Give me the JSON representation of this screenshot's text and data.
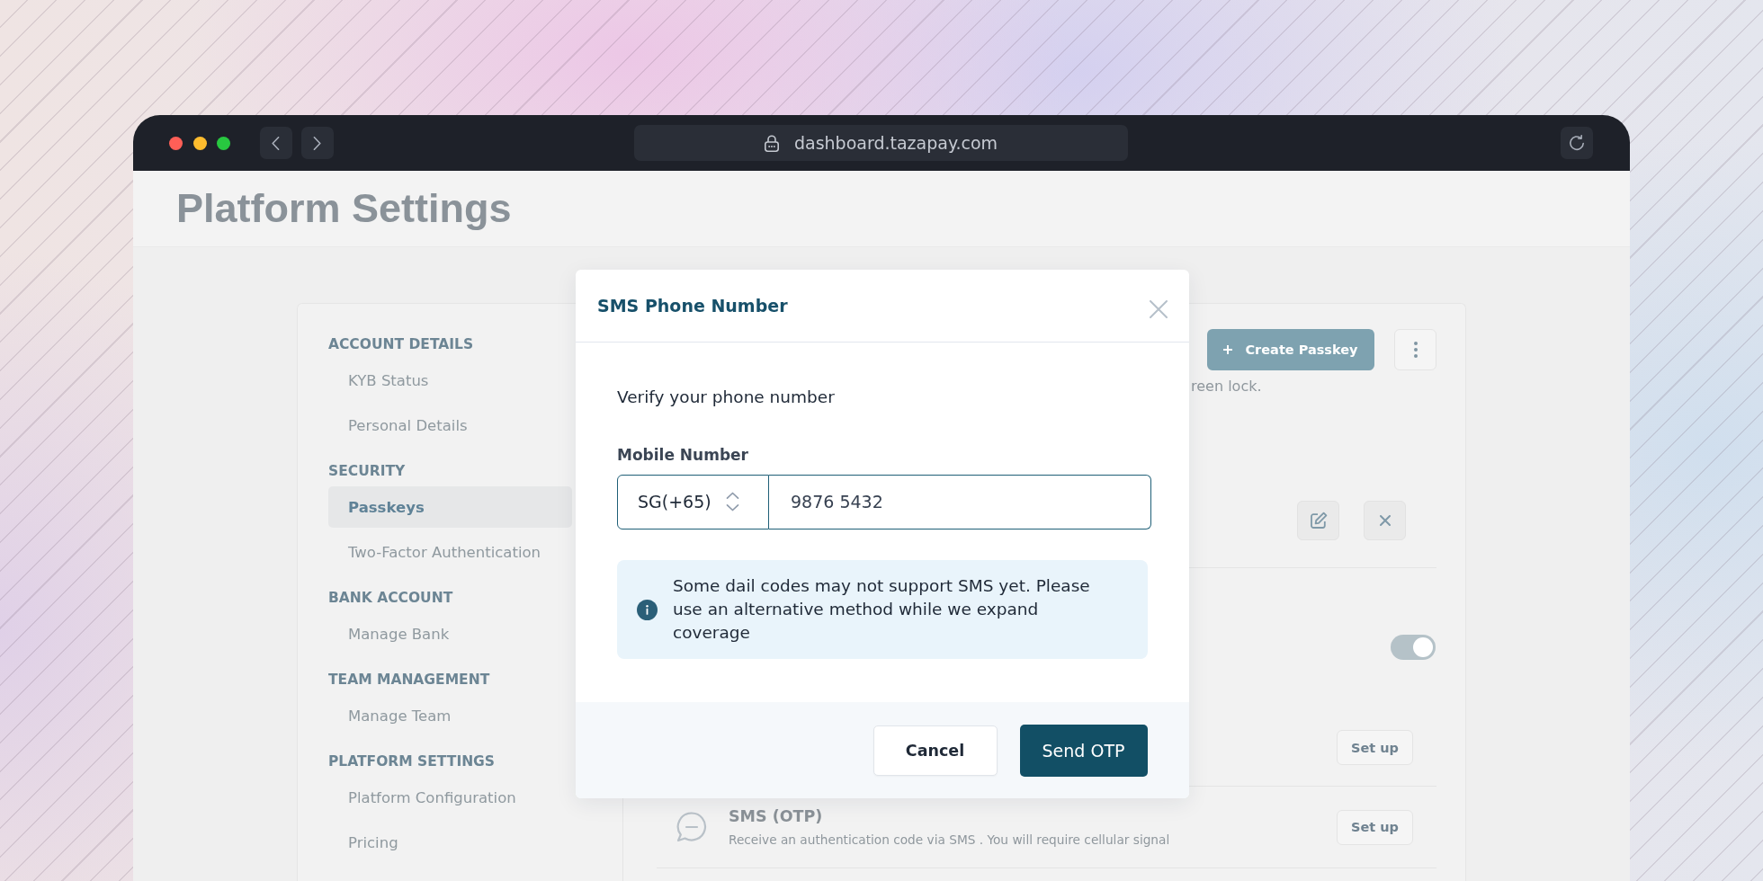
{
  "browser": {
    "url": "dashboard.tazapay.com"
  },
  "page": {
    "title": "Platform Settings",
    "sidebar": [
      {
        "heading": "ACCOUNT DETAILS",
        "items": [
          {
            "label": "KYB Status",
            "selected": false
          },
          {
            "label": "Personal Details",
            "selected": false
          }
        ]
      },
      {
        "heading": "SECURITY",
        "items": [
          {
            "label": "Passkeys",
            "selected": true
          },
          {
            "label": "Two-Factor Authentication",
            "selected": false
          }
        ]
      },
      {
        "heading": "BANK ACCOUNT",
        "items": [
          {
            "label": "Manage Bank",
            "selected": false
          }
        ]
      },
      {
        "heading": "TEAM MANAGEMENT",
        "items": [
          {
            "label": "Manage Team",
            "selected": false
          }
        ]
      },
      {
        "heading": "PLATFORM SETTINGS",
        "items": [
          {
            "label": "Platform Configuration",
            "selected": false
          },
          {
            "label": "Pricing",
            "selected": false
          }
        ]
      }
    ],
    "passkeys": {
      "create_button": "Create Passkey",
      "description": "reen lock."
    },
    "toggle": {
      "on": true
    },
    "methods": [
      {
        "button": "Set up"
      },
      {
        "title": "SMS (OTP)",
        "description": "Receive an authentication code via SMS . You will require cellular signal",
        "button": "Set up"
      }
    ]
  },
  "dialog": {
    "title": "SMS Phone Number",
    "prompt": "Verify your phone number",
    "field_label": "Mobile Number",
    "country_code": "SG(+65)",
    "phone": "9876 5432",
    "notice": "Some dail codes may not support SMS yet. Please use an alternative method while we expand coverage",
    "buttons": [
      {
        "label": "Cancel",
        "kind": "secondary"
      },
      {
        "label": "Send OTP",
        "kind": "primary"
      }
    ]
  }
}
